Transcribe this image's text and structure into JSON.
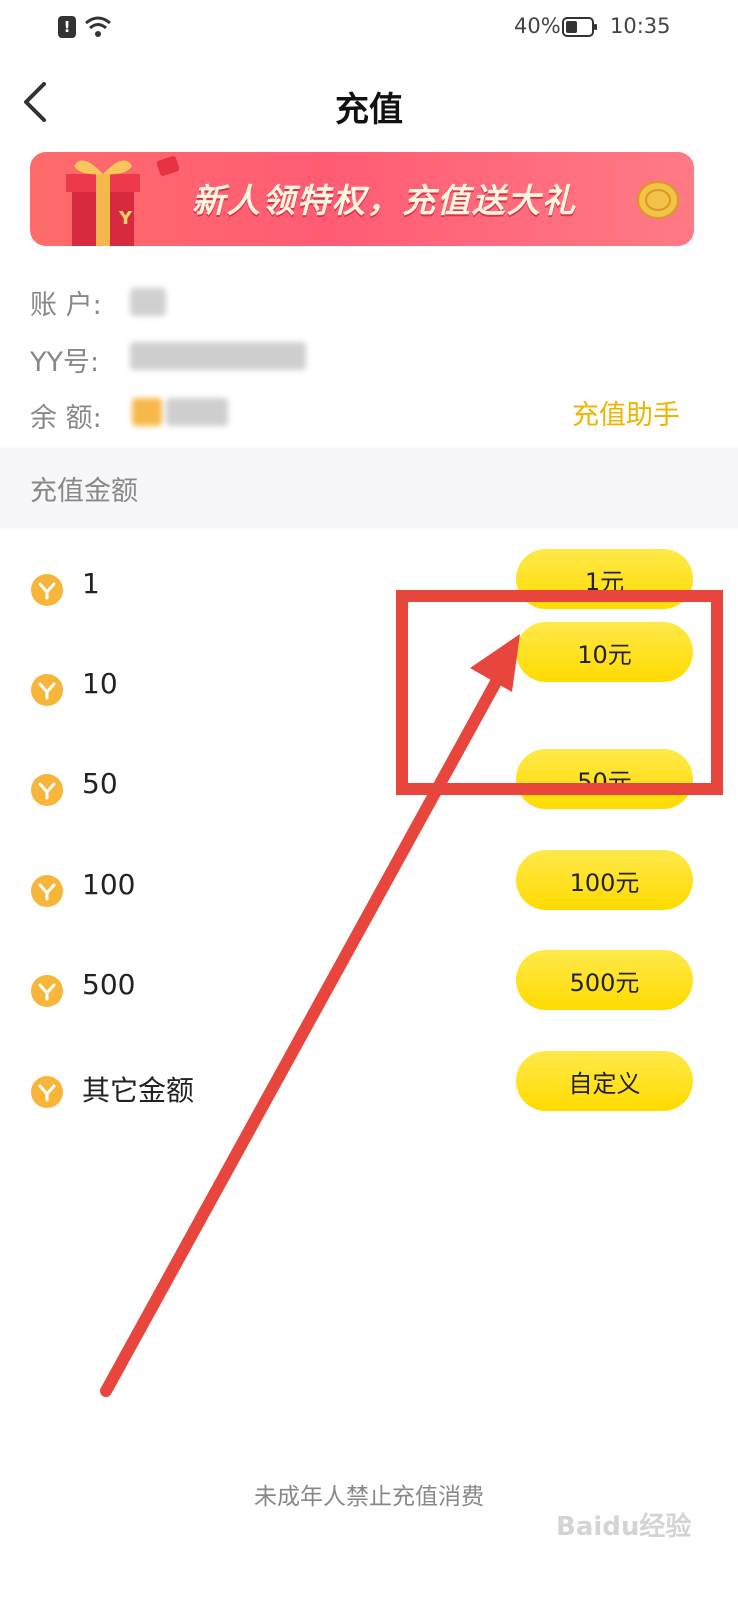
{
  "status_bar": {
    "battery": "40%",
    "time": "10:35"
  },
  "header": {
    "title": "充值"
  },
  "banner": {
    "text": "新人领特权，充值送大礼"
  },
  "account": {
    "account_label": "账 户:",
    "yy_label": "YY号:",
    "balance_label": "余 额:",
    "helper_link": "充值助手"
  },
  "section": {
    "label": "充值金额"
  },
  "options": [
    {
      "amount": "1",
      "button": "1元"
    },
    {
      "amount": "10",
      "button": "10元"
    },
    {
      "amount": "50",
      "button": "50元"
    },
    {
      "amount": "100",
      "button": "100元"
    },
    {
      "amount": "500",
      "button": "500元"
    },
    {
      "amount": "其它金额",
      "button": "自定义"
    }
  ],
  "footer": {
    "note": "未成年人禁止充值消费"
  },
  "watermark": {
    "text": "Baidu经验"
  },
  "colors": {
    "accent": "#f0b400",
    "button": "#ffe000",
    "banner": "#ff5c74",
    "annotation": "#e8453c"
  }
}
